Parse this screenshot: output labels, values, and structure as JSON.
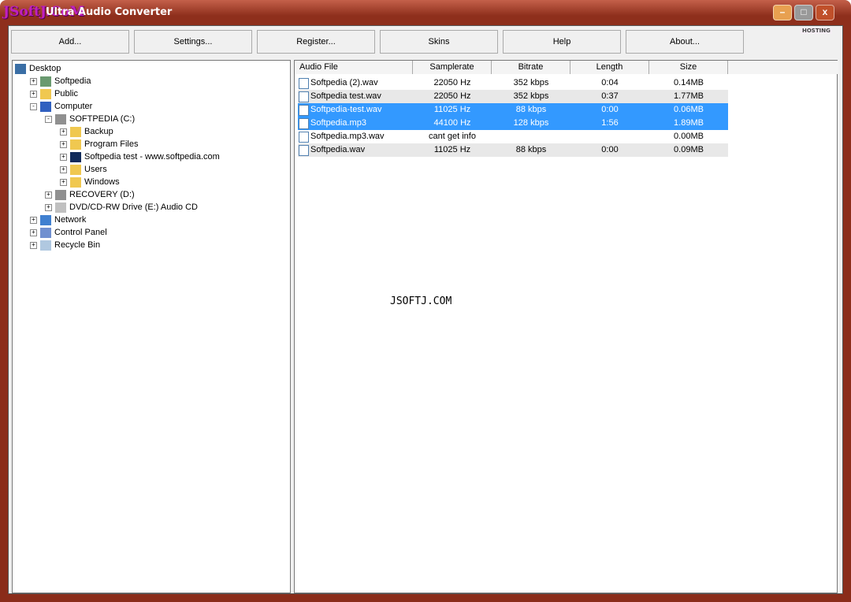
{
  "window": {
    "title": "Ultra Audio Converter",
    "logo_text": "JSoftJ.CoM",
    "minimize": "–",
    "maximize": "□",
    "close": "x",
    "hosting_badge": "HOSTING"
  },
  "toolbar": [
    {
      "label": "Add..."
    },
    {
      "label": "Settings..."
    },
    {
      "label": "Register..."
    },
    {
      "label": "Skins"
    },
    {
      "label": "Help"
    },
    {
      "label": "About..."
    }
  ],
  "tree": [
    {
      "label": "Desktop",
      "level": 0,
      "expander": "",
      "icon": "desktop-icon"
    },
    {
      "label": "Softpedia",
      "level": 1,
      "expander": "+",
      "icon": "user-folder-icon"
    },
    {
      "label": "Public",
      "level": 1,
      "expander": "+",
      "icon": "folder-icon"
    },
    {
      "label": "Computer",
      "level": 1,
      "expander": "-",
      "icon": "computer-icon"
    },
    {
      "label": "SOFTPEDIA (C:)",
      "level": 2,
      "expander": "-",
      "icon": "drive-icon"
    },
    {
      "label": "Backup",
      "level": 3,
      "expander": "+",
      "icon": "folder-icon"
    },
    {
      "label": "Program Files",
      "level": 3,
      "expander": "+",
      "icon": "folder-icon"
    },
    {
      "label": "Softpedia test - www.softpedia.com",
      "level": 3,
      "expander": "+",
      "icon": "softpedia-icon"
    },
    {
      "label": "Users",
      "level": 3,
      "expander": "+",
      "icon": "folder-icon"
    },
    {
      "label": "Windows",
      "level": 3,
      "expander": "+",
      "icon": "folder-icon"
    },
    {
      "label": "RECOVERY (D:)",
      "level": 2,
      "expander": "+",
      "icon": "drive-icon"
    },
    {
      "label": "DVD/CD-RW Drive (E:) Audio CD",
      "level": 2,
      "expander": "+",
      "icon": "cd-icon"
    },
    {
      "label": "Network",
      "level": 1,
      "expander": "+",
      "icon": "network-icon"
    },
    {
      "label": "Control Panel",
      "level": 1,
      "expander": "+",
      "icon": "control-panel-icon"
    },
    {
      "label": "Recycle Bin",
      "level": 1,
      "expander": "+",
      "icon": "recycle-bin-icon"
    }
  ],
  "files": {
    "columns": [
      "Audio File",
      "Samplerate",
      "Bitrate",
      "Length",
      "Size"
    ],
    "rows": [
      {
        "name": "Softpedia (2).wav",
        "samplerate": "22050 Hz",
        "bitrate": "352 kbps",
        "length": "0:04",
        "size": "0.14MB",
        "selected": false
      },
      {
        "name": "Softpedia test.wav",
        "samplerate": "22050 Hz",
        "bitrate": "352 kbps",
        "length": "0:37",
        "size": "1.77MB",
        "selected": false
      },
      {
        "name": "Softpedia-test.wav",
        "samplerate": "11025 Hz",
        "bitrate": "88 kbps",
        "length": "0:00",
        "size": "0.06MB",
        "selected": true
      },
      {
        "name": "Softpedia.mp3",
        "samplerate": "44100 Hz",
        "bitrate": "128 kbps",
        "length": "1:56",
        "size": "1.89MB",
        "selected": true
      },
      {
        "name": "Softpedia.mp3.wav",
        "samplerate": "cant get info",
        "bitrate": "",
        "length": "",
        "size": "0.00MB",
        "selected": false
      },
      {
        "name": "Softpedia.wav",
        "samplerate": "11025 Hz",
        "bitrate": "88 kbps",
        "length": "0:00",
        "size": "0.09MB",
        "selected": false
      }
    ]
  },
  "watermark": "JSOFTJ.COM",
  "colors": {
    "frame": "#8a2c1a",
    "selection": "#3399ff"
  }
}
